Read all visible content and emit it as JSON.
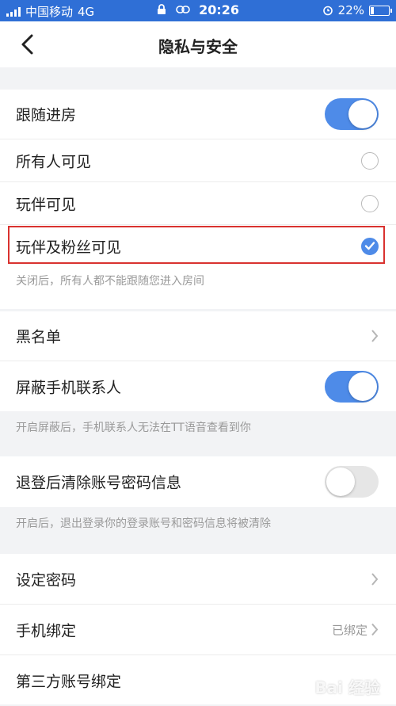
{
  "status_bar": {
    "carrier": "中国移动",
    "network": "4G",
    "time": "20:26",
    "battery": "22%",
    "battery_level": 0.22
  },
  "nav": {
    "title": "隐私与安全"
  },
  "follow_section": {
    "follow_room": {
      "label": "跟随进房",
      "on": true
    },
    "options": [
      {
        "label": "所有人可见",
        "selected": false
      },
      {
        "label": "玩伴可见",
        "selected": false
      },
      {
        "label": "玩伴及粉丝可见",
        "selected": true
      }
    ],
    "note": "关闭后，所有人都不能跟随您进入房间"
  },
  "blacklist_section": {
    "blacklist": {
      "label": "黑名单"
    },
    "block_contacts": {
      "label": "屏蔽手机联系人",
      "on": true
    },
    "note": "开启屏蔽后，手机联系人无法在TT语音查看到你"
  },
  "logout_section": {
    "clear_credentials": {
      "label": "退登后清除账号密码信息",
      "on": false
    },
    "note": "开启后，退出登录你的登录账号和密码信息将被清除"
  },
  "account_section": {
    "set_password": {
      "label": "设定密码"
    },
    "phone_binding": {
      "label": "手机绑定",
      "value": "已绑定"
    },
    "third_party_binding": {
      "label": "第三方账号绑定"
    }
  },
  "watermark": "Bai 经验",
  "colors": {
    "status_bar": "#2f6fd6",
    "accent": "#4e8be8",
    "highlight_border": "#d9322f",
    "background": "#f2f3f5"
  }
}
